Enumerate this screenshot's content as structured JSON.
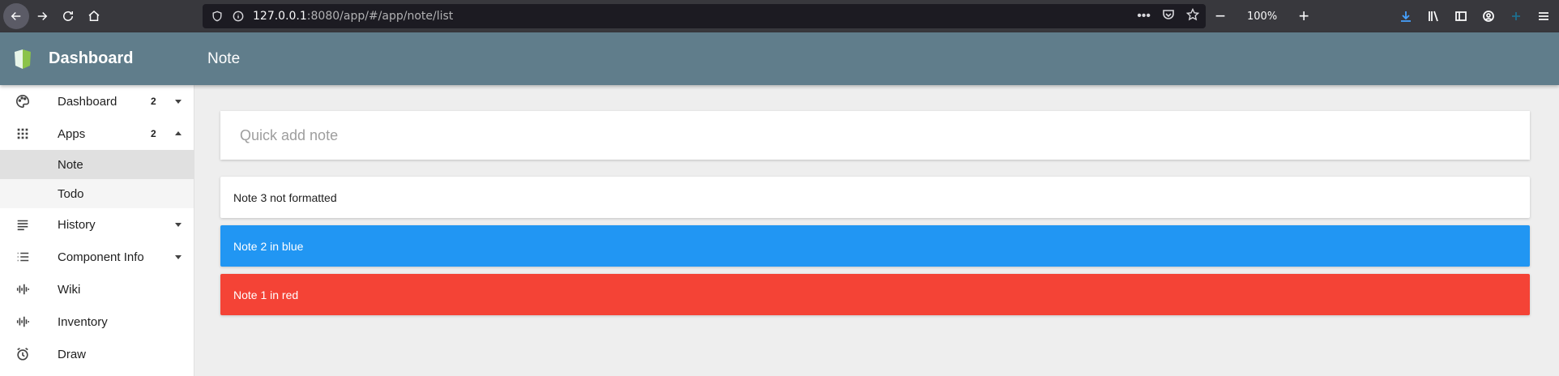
{
  "browser": {
    "url_host": "127.0.0.1",
    "url_path": ":8080/app/#/app/note/list",
    "zoom": "100%"
  },
  "header": {
    "brand": "Dashboard",
    "page_title": "Note"
  },
  "sidebar": {
    "items": [
      {
        "label": "Dashboard",
        "badge": "2",
        "icon": "palette-icon"
      },
      {
        "label": "Apps",
        "badge": "2",
        "icon": "apps-grid-icon"
      },
      {
        "label": "History",
        "icon": "history-list-icon"
      },
      {
        "label": "Component Info",
        "icon": "list-icon"
      },
      {
        "label": "Wiki",
        "icon": "waveform-icon"
      },
      {
        "label": "Inventory",
        "icon": "waveform-icon"
      },
      {
        "label": "Draw",
        "icon": "alarm-clock-icon"
      }
    ],
    "apps_children": [
      {
        "label": "Note"
      },
      {
        "label": "Todo"
      }
    ]
  },
  "main": {
    "quick_add_placeholder": "Quick add note",
    "notes": [
      {
        "text": "Note 3 not formatted",
        "bg": "#ffffff",
        "color": "#212121"
      },
      {
        "text": "Note 2 in blue",
        "bg": "#2196f3",
        "color": "#ffffff"
      },
      {
        "text": "Note 1 in red",
        "bg": "#f44336",
        "color": "#ffffff"
      }
    ]
  },
  "colors": {
    "header_bg": "#607d8b",
    "browser_bg": "#38383d",
    "content_bg": "#eeeeee"
  }
}
